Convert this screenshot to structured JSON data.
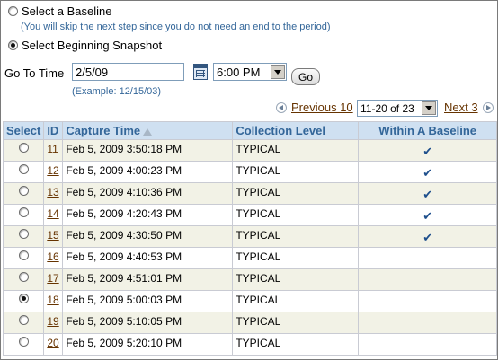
{
  "options": {
    "baseline_label": "Select a Baseline",
    "baseline_hint": "(You will skip the next step since you do not need an end to the period)",
    "snapshot_label": "Select Beginning Snapshot"
  },
  "goto": {
    "label": "Go To Time",
    "date_value": "2/5/09",
    "date_example": "(Example: 12/15/03)",
    "time_value": "6:00 PM",
    "go_label": "Go"
  },
  "pager": {
    "previous_label": "Previous 10",
    "range_value": "11-20 of 23",
    "next_label": "Next 3"
  },
  "table": {
    "headers": {
      "select": "Select",
      "id": "ID",
      "capture_time": "Capture Time",
      "collection_level": "Collection Level",
      "within_baseline": "Within A Baseline"
    },
    "rows": [
      {
        "id": "11",
        "time": "Feb 5, 2009 3:50:18 PM",
        "level": "TYPICAL",
        "baseline": true,
        "selected": false
      },
      {
        "id": "12",
        "time": "Feb 5, 2009 4:00:23 PM",
        "level": "TYPICAL",
        "baseline": true,
        "selected": false
      },
      {
        "id": "13",
        "time": "Feb 5, 2009 4:10:36 PM",
        "level": "TYPICAL",
        "baseline": true,
        "selected": false
      },
      {
        "id": "14",
        "time": "Feb 5, 2009 4:20:43 PM",
        "level": "TYPICAL",
        "baseline": true,
        "selected": false
      },
      {
        "id": "15",
        "time": "Feb 5, 2009 4:30:50 PM",
        "level": "TYPICAL",
        "baseline": true,
        "selected": false
      },
      {
        "id": "16",
        "time": "Feb 5, 2009 4:40:53 PM",
        "level": "TYPICAL",
        "baseline": false,
        "selected": false
      },
      {
        "id": "17",
        "time": "Feb 5, 2009 4:51:01 PM",
        "level": "TYPICAL",
        "baseline": false,
        "selected": false
      },
      {
        "id": "18",
        "time": "Feb 5, 2009 5:00:03 PM",
        "level": "TYPICAL",
        "baseline": false,
        "selected": true
      },
      {
        "id": "19",
        "time": "Feb 5, 2009 5:10:05 PM",
        "level": "TYPICAL",
        "baseline": false,
        "selected": false
      },
      {
        "id": "20",
        "time": "Feb 5, 2009 5:20:10 PM",
        "level": "TYPICAL",
        "baseline": false,
        "selected": false
      }
    ]
  },
  "colors": {
    "header_bg": "#cfe0f1",
    "header_text": "#336699",
    "link": "#663300",
    "alt_row": "#f2f2e6"
  }
}
